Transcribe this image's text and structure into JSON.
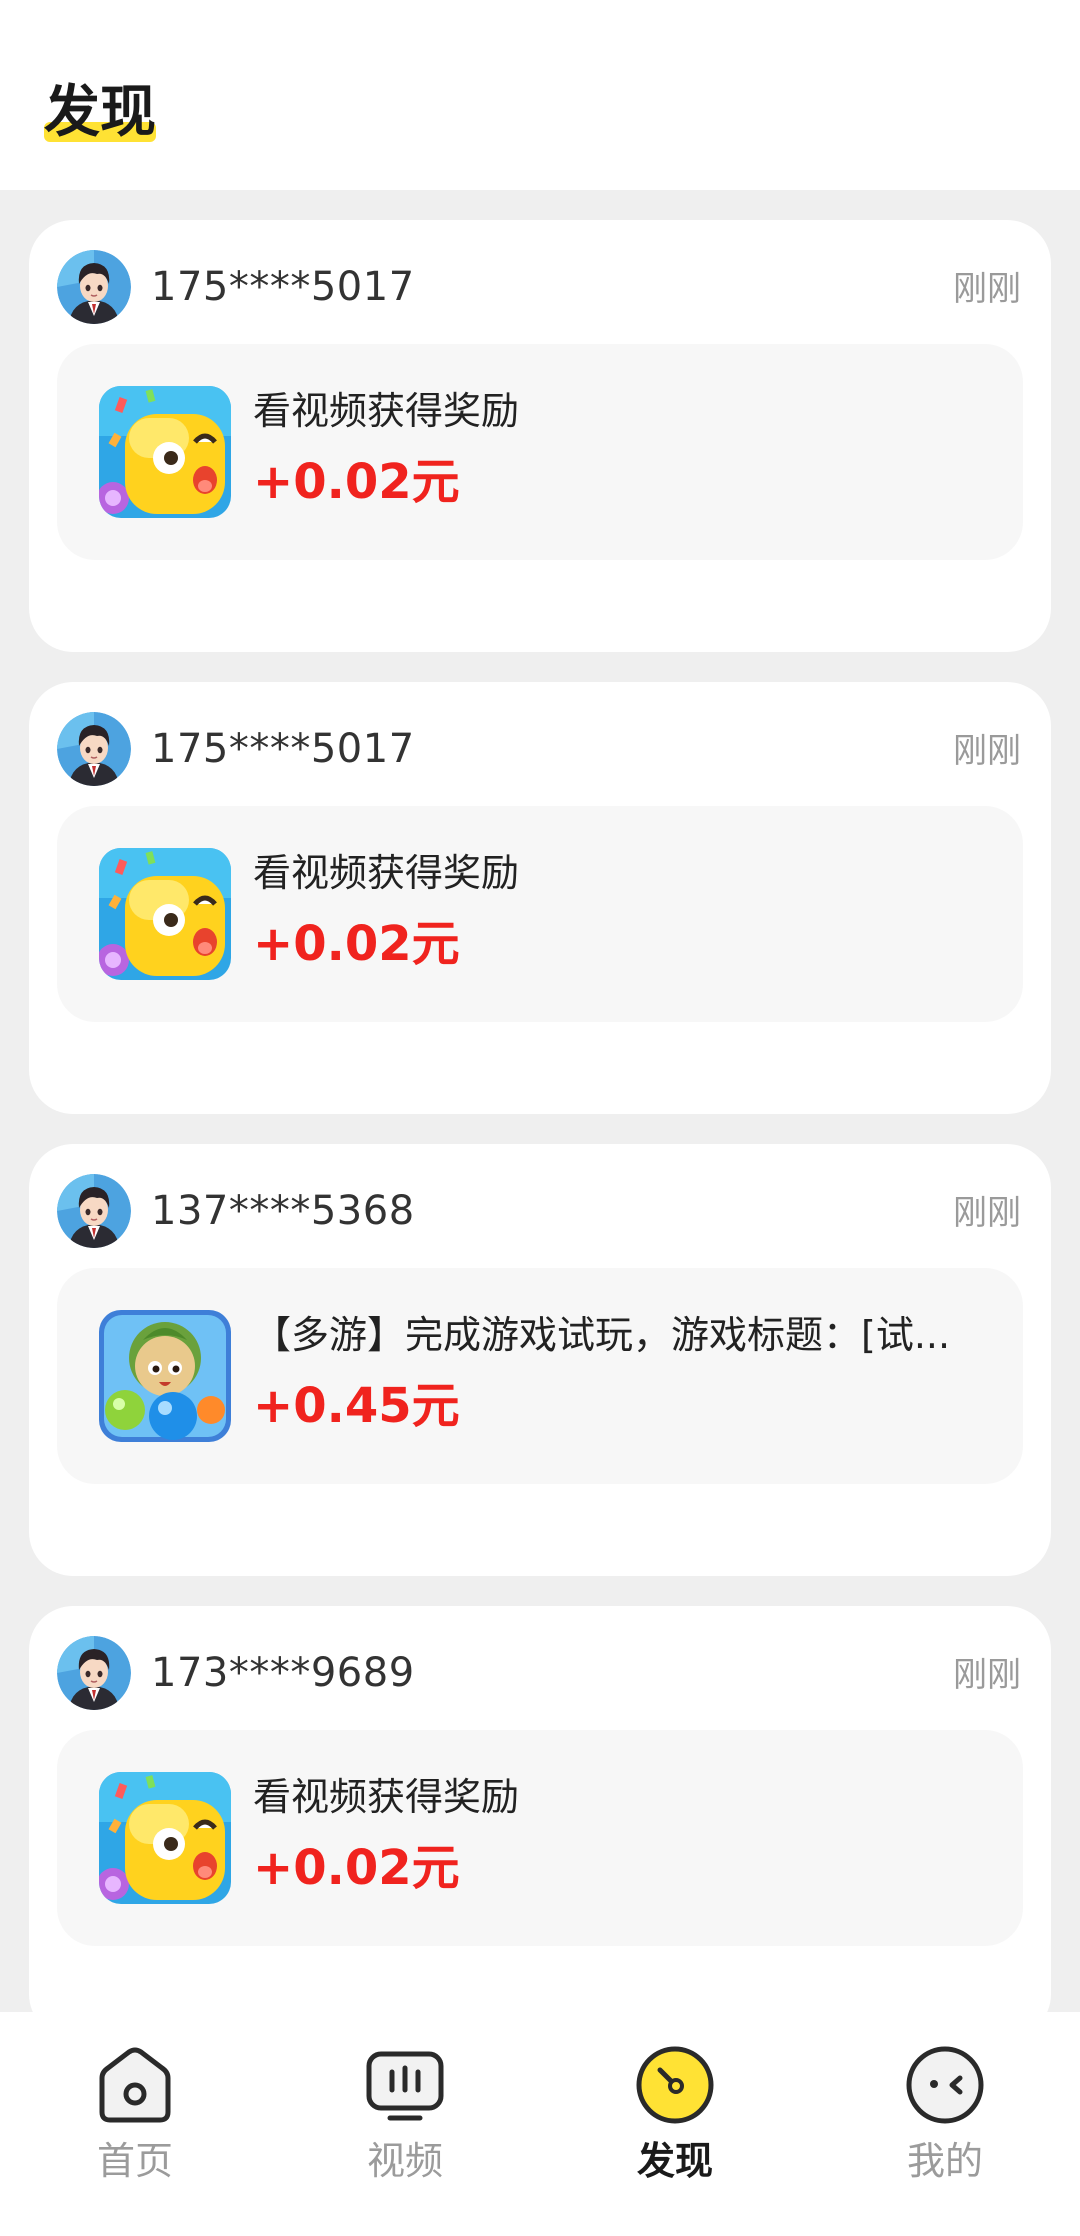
{
  "page": {
    "title": "发现"
  },
  "feed": [
    {
      "user": "175****5017",
      "time": "刚刚",
      "icon": "yellow-blob-game-icon",
      "task_title": "看视频获得奖励",
      "reward": "+0.02元"
    },
    {
      "user": "175****5017",
      "time": "刚刚",
      "icon": "yellow-blob-game-icon",
      "task_title": "看视频获得奖励",
      "reward": "+0.02元"
    },
    {
      "user": "137****5368",
      "time": "刚刚",
      "icon": "bubble-shooter-game-icon",
      "task_title": "【多游】完成游戏试玩，游戏标题：[试...",
      "reward": "+0.45元"
    },
    {
      "user": "173****9689",
      "time": "刚刚",
      "icon": "yellow-blob-game-icon",
      "task_title": "看视频获得奖励",
      "reward": "+0.02元"
    }
  ],
  "tabbar": {
    "items": [
      {
        "label": "首页",
        "icon": "home-icon"
      },
      {
        "label": "视频",
        "icon": "video-icon"
      },
      {
        "label": "发现",
        "icon": "discover-icon"
      },
      {
        "label": "我的",
        "icon": "profile-icon"
      }
    ],
    "active_index": 2
  },
  "colors": {
    "accent": "#ffe234",
    "reward": "#f0231e",
    "background": "#efefef"
  }
}
